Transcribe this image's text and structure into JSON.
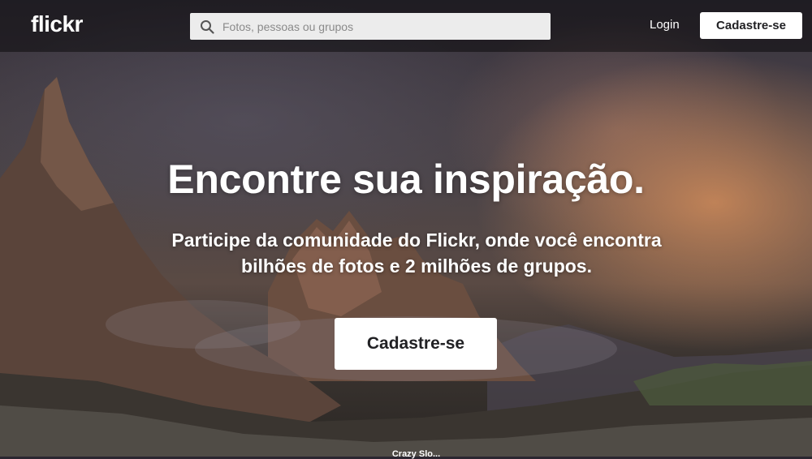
{
  "header": {
    "logo": "flickr",
    "search_placeholder": "Fotos, pessoas ou grupos",
    "login_label": "Login",
    "signup_label": "Cadastre-se"
  },
  "hero": {
    "headline": "Encontre sua inspiração.",
    "subheadline": "Participe da comunidade do Flickr, onde você encontra bilhões de fotos e 2 milhões de grupos.",
    "cta_label": "Cadastre-se",
    "photo_credit": "Crazy Slo..."
  },
  "icons": {
    "search": "search-icon"
  },
  "colors": {
    "topbar": "#000000",
    "button_bg": "#ffffff",
    "button_text": "#212124",
    "search_bg": "#ececec"
  }
}
